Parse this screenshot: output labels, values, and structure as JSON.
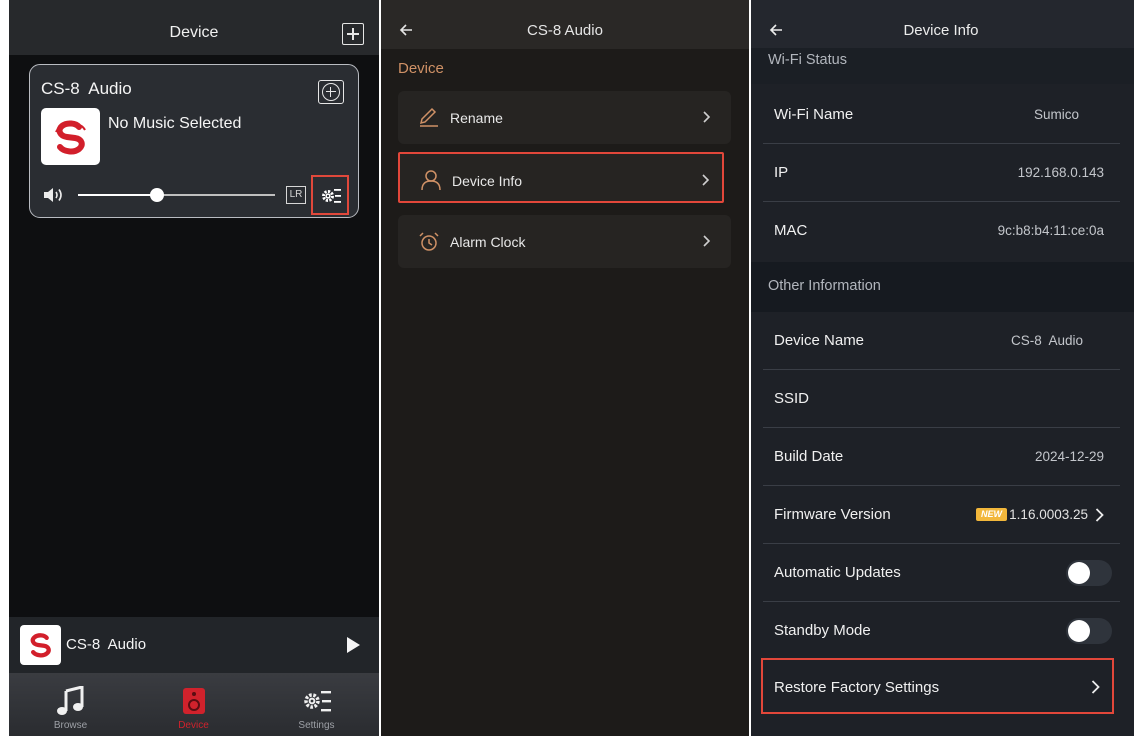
{
  "device_list": {
    "title": "Device",
    "card": {
      "device_name": "CS-8  Audio",
      "status": "No Music Selected",
      "volume": 0.4,
      "channel_badge": "LR"
    },
    "mini_player": {
      "device_name": "CS-8  Audio"
    },
    "tabs": [
      {
        "label": "Browse",
        "icon": "music-note-icon"
      },
      {
        "label": "Device",
        "icon": "speaker-icon",
        "active": true
      },
      {
        "label": "Settings",
        "icon": "settings-icon"
      }
    ]
  },
  "device_menu": {
    "title": "CS-8 Audio",
    "section": "Device",
    "items": [
      {
        "label": "Rename",
        "icon": "pencil-icon"
      },
      {
        "label": "Device Info",
        "icon": "user-icon",
        "highlighted": true
      },
      {
        "label": "Alarm Clock",
        "icon": "alarm-clock-icon"
      }
    ]
  },
  "device_info": {
    "title": "Device Info",
    "wifi_section": "Wi-Fi Status",
    "wifi_rows": [
      {
        "label": "Wi-Fi Name",
        "value": "Sumico"
      },
      {
        "label": "IP",
        "value": "192.168.0.143"
      },
      {
        "label": "MAC",
        "value": "9c:b8:b4:11:ce:0a"
      }
    ],
    "other_section": "Other Information",
    "other_rows": [
      {
        "label": "Device Name",
        "value": "CS-8  Audio"
      },
      {
        "label": "SSID",
        "value": ""
      },
      {
        "label": "Build Date",
        "value": "2024-12-29"
      }
    ],
    "firmware": {
      "label": "Firmware Version",
      "badge": "NEW",
      "value": "1.16.0003.25"
    },
    "auto_updates": {
      "label": "Automatic Updates",
      "enabled": false
    },
    "standby": {
      "label": "Standby Mode",
      "enabled": false
    },
    "restore": {
      "label": "Restore Factory Settings"
    }
  },
  "colors": {
    "accent_red": "#e2473a",
    "brand_red": "#d0222c",
    "section_orange": "#cf9166",
    "new_badge": "#f2b73b"
  }
}
